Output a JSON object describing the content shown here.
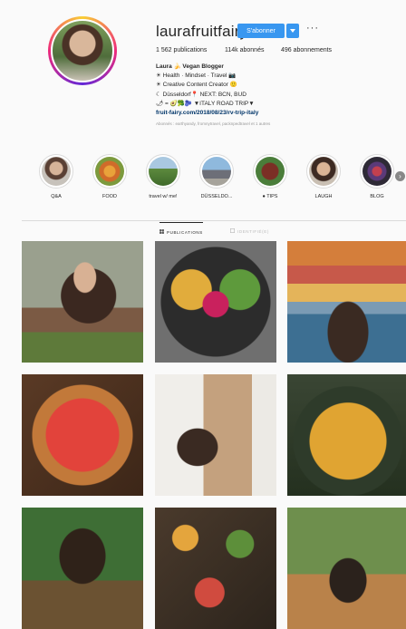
{
  "profile": {
    "username": "laurafruitfairy",
    "follow_label": "S'abonner",
    "dropdown_icon": "chevron-down-icon",
    "more_label": "···",
    "stats": {
      "posts": "1 562 publications",
      "followers": "114k abonnés",
      "following": "496 abonnements"
    },
    "bio": {
      "name": "Laura 🍌 Vegan Blogger",
      "line1": "☀ Health · Mindset · Travel 📷",
      "line2": "☀ Creative Content Creator 🙂",
      "line3": "☾ Düsseldorf📍 NEXT: BCN, BUD",
      "line4": "🌶 = 🥑🥦🫐 ▼ITALY ROAD TRIP▼",
      "link": "fruit-fairy.com/2018/08/23/rv-trip-italy",
      "followed_by": "Abonnés : earthyandy, fromnytravel, packnpedtravel et 1 autres"
    }
  },
  "highlights": [
    {
      "label": "Q&A"
    },
    {
      "label": "FOOD"
    },
    {
      "label": "travel w/ me!"
    },
    {
      "label": "DÜSSELDO..."
    },
    {
      "label": "● TIPS"
    },
    {
      "label": "LAUGH"
    },
    {
      "label": "BLOG"
    }
  ],
  "tabs": {
    "publications": "PUBLICATIONS",
    "identified": "IDENTIFIÉ(E)"
  },
  "colors": {
    "primary": "#3897f0",
    "text": "#262626",
    "background": "#fafafa"
  }
}
